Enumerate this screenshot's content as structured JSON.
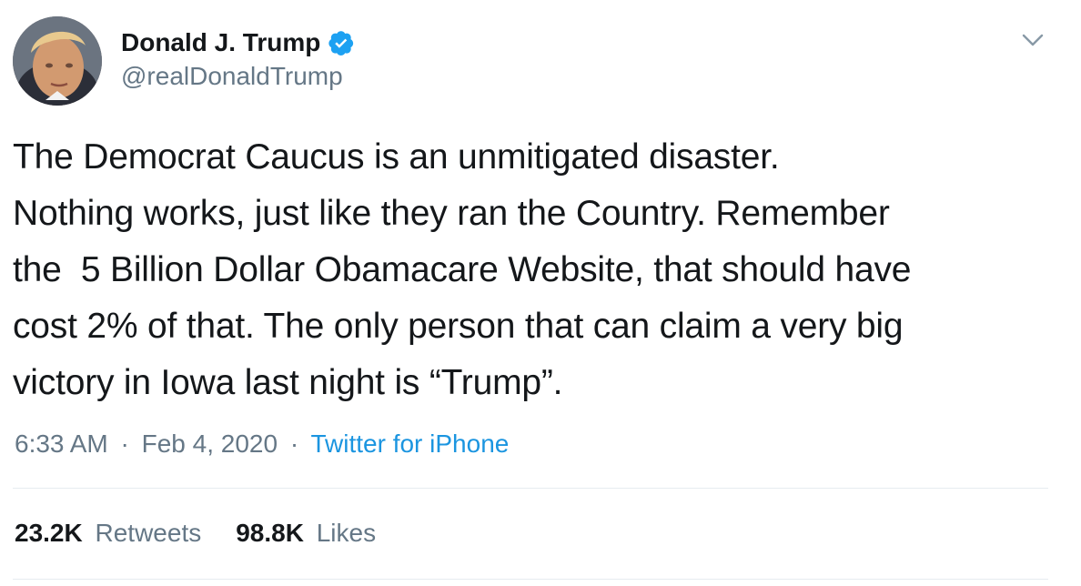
{
  "author": {
    "display_name": "Donald J. Trump",
    "handle": "@realDonaldTrump",
    "verified": true,
    "avatar_icon": "profile-photo"
  },
  "menu": {
    "icon": "chevron-down-icon"
  },
  "tweet": {
    "text": "The Democrat Caucus is an unmitigated disaster.\nNothing works, just like they ran the Country. Remember\nthe  5 Billion Dollar Obamacare Website, that should have\ncost 2% of that. The only person that can claim a very big\nvictory in Iowa last night is “Trump”."
  },
  "meta": {
    "time": "6:33 AM",
    "separator": "·",
    "date": "Feb 4, 2020",
    "source": "Twitter for iPhone"
  },
  "stats": {
    "retweets_count": "23.2K",
    "retweets_label": "Retweets",
    "likes_count": "98.8K",
    "likes_label": "Likes"
  },
  "colors": {
    "text": "#14171a",
    "secondary": "#657786",
    "link": "#1b95e0",
    "verified": "#1da1f2",
    "divider": "#e6ecf0"
  }
}
